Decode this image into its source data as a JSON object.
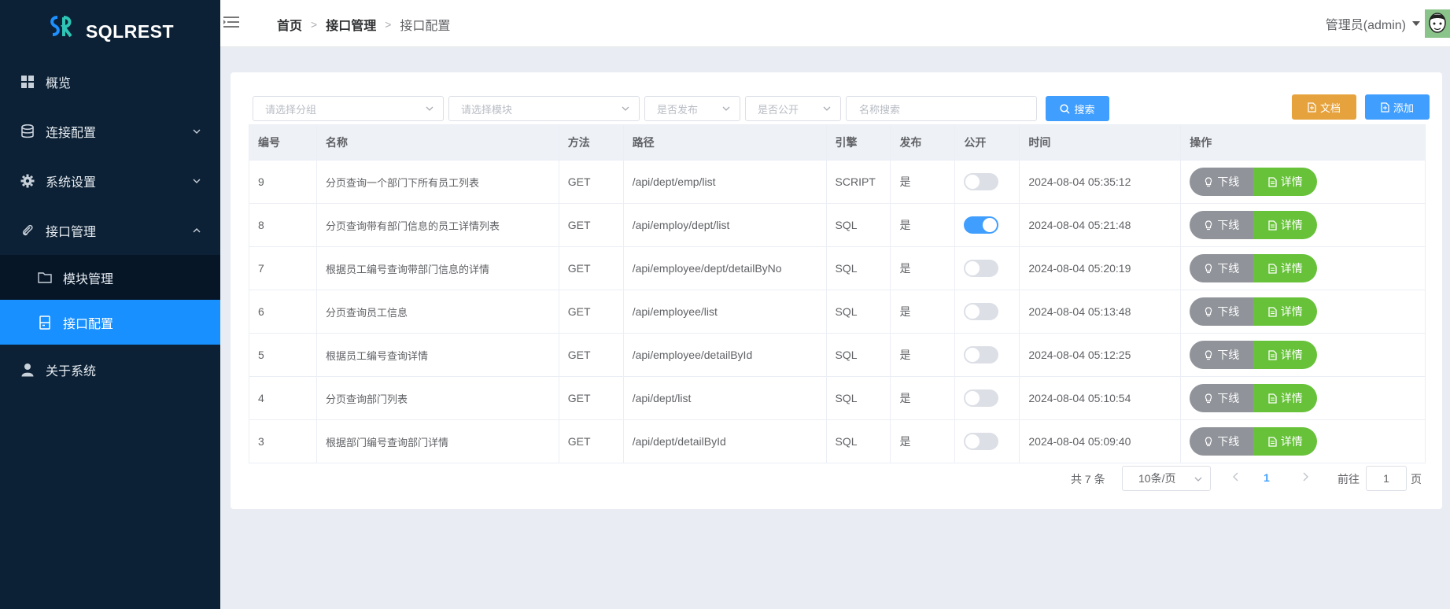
{
  "brand": {
    "name": "SQLREST",
    "accent": "#1890ff",
    "sidebar_bg": "#0c2135"
  },
  "sidebar": {
    "items": [
      {
        "label": "概览",
        "icon": "grid-icon"
      },
      {
        "label": "连接配置",
        "icon": "database-icon",
        "expandable": true
      },
      {
        "label": "系统设置",
        "icon": "gear-icon",
        "expandable": true
      },
      {
        "label": "接口管理",
        "icon": "paperclip-icon",
        "expanded": true
      },
      {
        "label": "模块管理",
        "icon": "folder-icon"
      },
      {
        "label": "接口配置",
        "icon": "document-icon",
        "active": true
      },
      {
        "label": "关于系统",
        "icon": "user-icon"
      }
    ]
  },
  "header": {
    "breadcrumb": [
      "首页",
      "接口管理",
      "接口配置"
    ],
    "user": "管理员(admin)"
  },
  "filters": {
    "group_placeholder": "请选择分组",
    "module_placeholder": "请选择模块",
    "publish_placeholder": "是否发布",
    "public_placeholder": "是否公开",
    "name_placeholder": "名称搜索",
    "search_label": "搜索",
    "docs_label": "文档",
    "add_label": "添加"
  },
  "table": {
    "columns": [
      "编号",
      "名称",
      "方法",
      "路径",
      "引擎",
      "发布",
      "公开",
      "时间",
      "操作"
    ],
    "rows": [
      {
        "id": "9",
        "name": "分页查询一个部门下所有员工列表",
        "method": "GET",
        "path": "/api/dept/emp/list",
        "engine": "SCRIPT",
        "published": "是",
        "public": false,
        "time": "2024-08-04 05:35:12"
      },
      {
        "id": "8",
        "name": "分页查询带有部门信息的员工详情列表",
        "method": "GET",
        "path": "/api/employ/dept/list",
        "engine": "SQL",
        "published": "是",
        "public": true,
        "time": "2024-08-04 05:21:48"
      },
      {
        "id": "7",
        "name": "根据员工编号查询带部门信息的详情",
        "method": "GET",
        "path": "/api/employee/dept/detailByNo",
        "engine": "SQL",
        "published": "是",
        "public": false,
        "time": "2024-08-04 05:20:19"
      },
      {
        "id": "6",
        "name": "分页查询员工信息",
        "method": "GET",
        "path": "/api/employee/list",
        "engine": "SQL",
        "published": "是",
        "public": false,
        "time": "2024-08-04 05:13:48"
      },
      {
        "id": "5",
        "name": "根据员工编号查询详情",
        "method": "GET",
        "path": "/api/employee/detailById",
        "engine": "SQL",
        "published": "是",
        "public": false,
        "time": "2024-08-04 05:12:25"
      },
      {
        "id": "4",
        "name": "分页查询部门列表",
        "method": "GET",
        "path": "/api/dept/list",
        "engine": "SQL",
        "published": "是",
        "public": false,
        "time": "2024-08-04 05:10:54"
      },
      {
        "id": "3",
        "name": "根据部门编号查询部门详情",
        "method": "GET",
        "path": "/api/dept/detailById",
        "engine": "SQL",
        "published": "是",
        "public": false,
        "time": "2024-08-04 05:09:40"
      }
    ],
    "offline_label": "下线",
    "detail_label": "详情"
  },
  "pagination": {
    "total_label": "共 7 条",
    "page_size": "10条/页",
    "current_page": "1",
    "goto_label": "前往",
    "goto_value": "1",
    "page_suffix": "页"
  }
}
